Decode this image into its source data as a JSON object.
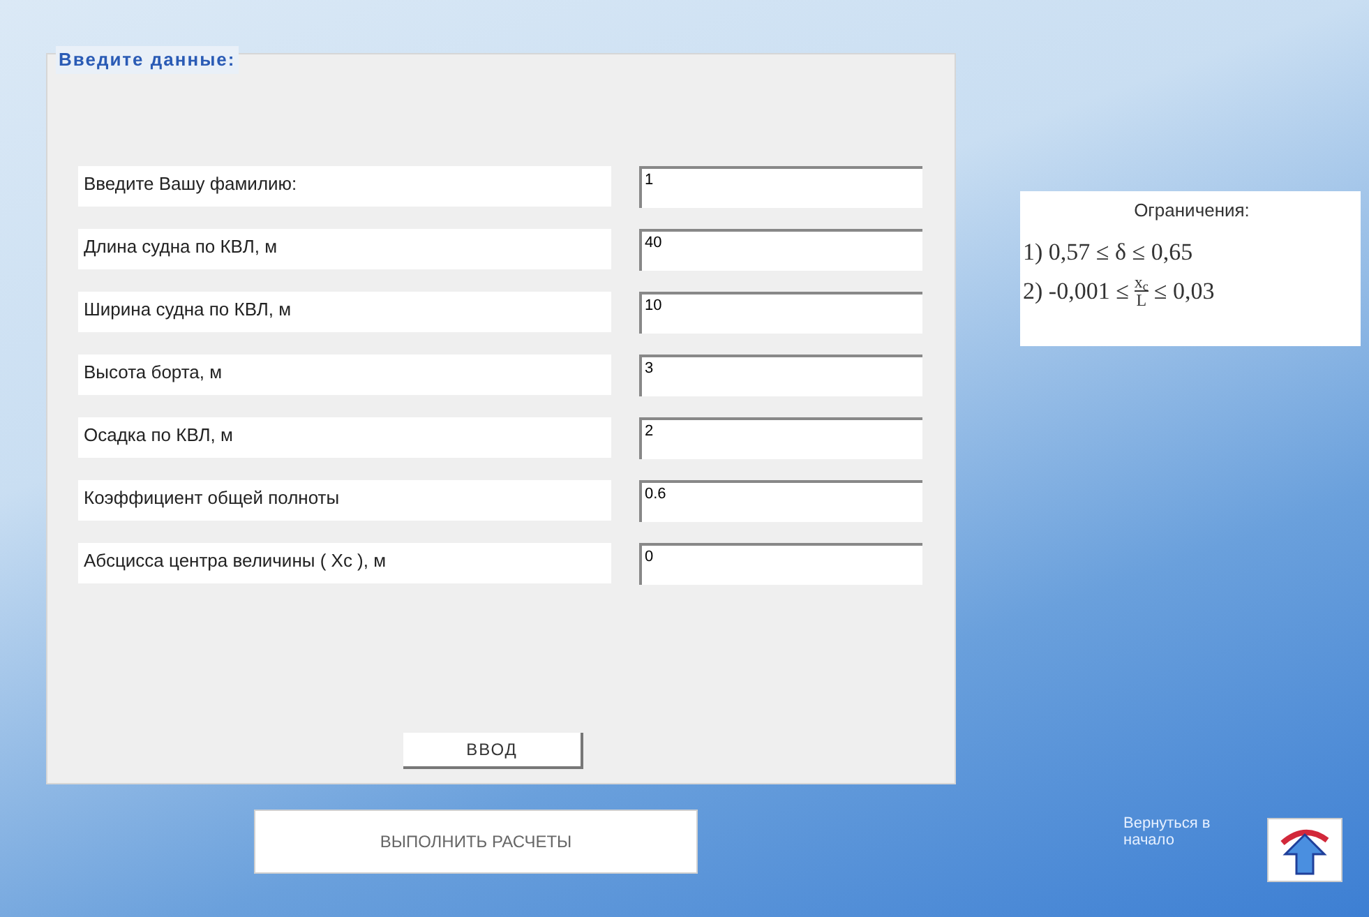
{
  "form": {
    "legend": "Введите данные:",
    "fields": [
      {
        "label": "Введите Вашу фамилию:",
        "value": "1"
      },
      {
        "label": "Длина судна по КВЛ, м",
        "value": "40"
      },
      {
        "label": "Ширина судна по КВЛ, м",
        "value": "10"
      },
      {
        "label": "Высота борта, м",
        "value": "3"
      },
      {
        "label": "Осадка по КВЛ, м",
        "value": "2"
      },
      {
        "label": "Коэффициент общей полноты",
        "value": "0.6"
      },
      {
        "label": "Абсцисса центра величины ( Хс ), м",
        "value": "0"
      }
    ],
    "submit": "ВВОД"
  },
  "constraints": {
    "title": "Ограничения:",
    "line_1": "1) 0,57 ≤ δ ≤ 0,65",
    "line_2": {
      "prefix": "2) -0,001 ≤",
      "numerator": "x$_{c}$",
      "denominator": "L",
      "suffix": "≤ 0,03"
    }
  },
  "calculate_button": "ВЫПОЛНИТЬ РАСЧЕТЫ",
  "home": {
    "label": "Вернуться в начало"
  }
}
